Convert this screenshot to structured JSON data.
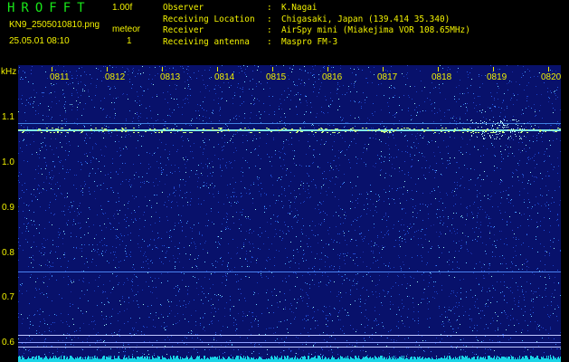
{
  "header": {
    "app_title": "HROFFT",
    "version": "1.00f",
    "filename": "KN9_2505010810.png",
    "meteor_label": "meteor",
    "datetime": "25.05.01 08:10",
    "count": "1"
  },
  "info": [
    {
      "key": "Observer",
      "sep": ":",
      "value": "K.Nagai"
    },
    {
      "key": "Receiving Location",
      "sep": ":",
      "value": "Chigasaki, Japan (139.414 35.340)"
    },
    {
      "key": "Receiver",
      "sep": ":",
      "value": "AirSpy mini (Miakejima VOR 108.65MHz)"
    },
    {
      "key": "Receiving antenna",
      "sep": ":",
      "value": "Maspro FM-3"
    }
  ],
  "axis": {
    "y_unit": "kHz",
    "y_ticks": [
      "1.1",
      "1.0",
      "0.9",
      "0.8",
      "0.7",
      "0.6"
    ],
    "x_ticks": [
      "0811",
      "0812",
      "0813",
      "0814",
      "0815",
      "0816",
      "0817",
      "0818",
      "0819",
      "0820"
    ]
  },
  "colors": {
    "background": "#000000",
    "label_yellow": "#f2f200",
    "title_green": "#19e619",
    "plot_blue": "#08116b",
    "trace_cyan": "#7fe8e8"
  }
}
